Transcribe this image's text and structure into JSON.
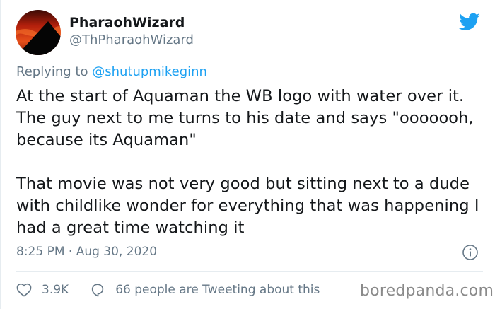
{
  "author": {
    "display_name": "PharaohWizard",
    "handle": "@ThPharaohWizard"
  },
  "reply_context": {
    "prefix": "Replying to",
    "mention": "@shutupmikeginn"
  },
  "tweet": {
    "paragraphs": [
      "At the start of Aquaman the WB logo with water over it. The guy next to me turns to his date and says \"ooooooh, because its Aquaman\"",
      "That movie was not very good but sitting next to a dude with childlike wonder for everything that was happening I had a great time watching it"
    ],
    "timestamp": "8:25 PM · Aug 30, 2020"
  },
  "actions": {
    "like_count": "3.9K",
    "reply_text": "66 people are Tweeting about this"
  },
  "watermark": "boredpanda.com",
  "icons": {
    "brand": "twitter-bird-icon",
    "info": "info-icon",
    "like": "heart-icon",
    "reply": "speech-bubble-icon"
  },
  "colors": {
    "twitter_blue": "#1da1f2",
    "secondary_text": "#657786",
    "primary_text": "#14171a"
  }
}
